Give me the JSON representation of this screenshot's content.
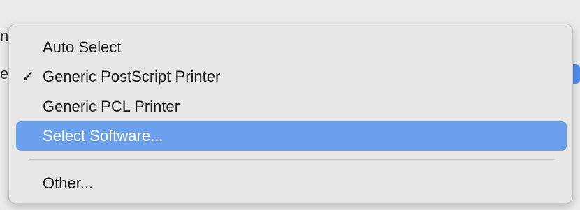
{
  "background": {
    "left_fragment_top": "n",
    "left_fragment_middle": "e"
  },
  "menu": {
    "items": [
      {
        "label": "Auto Select",
        "checked": false,
        "highlighted": false
      },
      {
        "label": "Generic PostScript Printer",
        "checked": true,
        "highlighted": false
      },
      {
        "label": "Generic PCL Printer",
        "checked": false,
        "highlighted": false
      },
      {
        "label": "Select Software...",
        "checked": false,
        "highlighted": true
      },
      {
        "label": "Other...",
        "checked": false,
        "highlighted": false
      }
    ],
    "checkmark": "✓",
    "highlight_color": "#6aa0ec",
    "background_color": "#e7e7e7",
    "text_color": "#1a1a1a",
    "highlight_text_color": "#ffffff"
  }
}
